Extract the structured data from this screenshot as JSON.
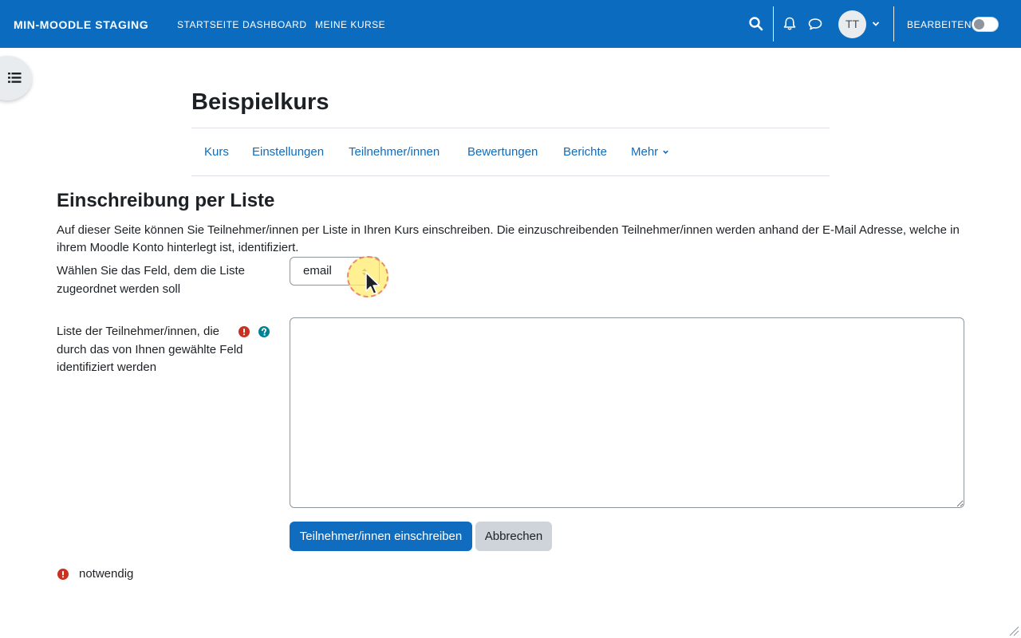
{
  "navbar": {
    "brand": "MIN-MOODLE STAGING",
    "links": [
      "STARTSEITE",
      "DASHBOARD",
      "MEINE KURSE"
    ],
    "avatar_initials": "TT",
    "edit_label": "BEARBEITEN",
    "edit_mode_on": false,
    "bg_color": "#0b6cbf"
  },
  "course": {
    "title": "Beispielkurs",
    "tabs": [
      "Kurs",
      "Einstellungen",
      "Teilnehmer/innen",
      "Bewertungen",
      "Berichte",
      "Mehr"
    ]
  },
  "page": {
    "heading": "Einschreibung per Liste",
    "intro": "Auf dieser Seite können Sie Teilnehmer/innen per Liste in Ihren Kurs einschreiben. Die einzuschreibenden Teilnehmer/innen werden anhand der E-Mail Adresse, welche in ihrem Moodle Konto hinterlegt ist, identifiziert.",
    "field_label": "Wählen Sie das Feld, dem die Liste zugeordnet werden soll",
    "field_value": "email",
    "list_label": "Liste der Teilnehmer/innen, die durch das von Ihnen gewählte Feld identifiziert werden",
    "list_value": "",
    "submit_label": "Teilnehmer/innen einschreiben",
    "cancel_label": "Abbrechen",
    "required_note": "notwendig"
  },
  "colors": {
    "primary": "#0f6cbf",
    "required": "#ca3120",
    "help": "#008196"
  }
}
